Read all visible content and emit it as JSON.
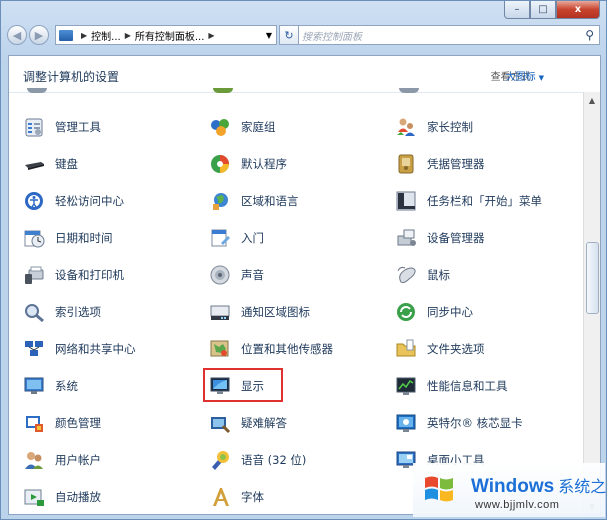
{
  "window": {
    "caption_buttons": {
      "minimize": "–",
      "maximize": "□",
      "close": "x"
    }
  },
  "nav": {
    "back_icon": "back-arrow-icon",
    "forward_icon": "forward-arrow-icon",
    "address_parts": [
      "控制...",
      "所有控制面板...",
      ""
    ],
    "refresh_icon": "refresh-icon",
    "search_placeholder": "搜索控制面板"
  },
  "header": {
    "title": "调整计算机的设置",
    "view_by_label": "查看方式:",
    "view_by_value": "大图标"
  },
  "columns": [
    {
      "items": [
        {
          "label": "管理工具",
          "icon": "admin-tools-icon"
        },
        {
          "label": "键盘",
          "icon": "keyboard-icon"
        },
        {
          "label": "轻松访问中心",
          "icon": "ease-of-access-icon"
        },
        {
          "label": "日期和时间",
          "icon": "date-time-icon"
        },
        {
          "label": "设备和打印机",
          "icon": "devices-printers-icon"
        },
        {
          "label": "索引选项",
          "icon": "indexing-options-icon"
        },
        {
          "label": "网络和共享中心",
          "icon": "network-sharing-icon"
        },
        {
          "label": "系统",
          "icon": "system-icon"
        },
        {
          "label": "颜色管理",
          "icon": "color-management-icon"
        },
        {
          "label": "用户帐户",
          "icon": "user-accounts-icon"
        },
        {
          "label": "自动播放",
          "icon": "autoplay-icon"
        }
      ]
    },
    {
      "items": [
        {
          "label": "家庭组",
          "icon": "homegroup-icon"
        },
        {
          "label": "默认程序",
          "icon": "default-programs-icon"
        },
        {
          "label": "区域和语言",
          "icon": "region-language-icon"
        },
        {
          "label": "入门",
          "icon": "getting-started-icon"
        },
        {
          "label": "声音",
          "icon": "sound-icon"
        },
        {
          "label": "通知区域图标",
          "icon": "notification-icons-icon"
        },
        {
          "label": "位置和其他传感器",
          "icon": "location-sensors-icon"
        },
        {
          "label": "显示",
          "icon": "display-icon"
        },
        {
          "label": "疑难解答",
          "icon": "troubleshooting-icon"
        },
        {
          "label": "语音 (32 位)",
          "icon": "speech-icon"
        },
        {
          "label": "字体",
          "icon": "fonts-icon"
        }
      ]
    },
    {
      "items": [
        {
          "label": "家长控制",
          "icon": "parental-controls-icon"
        },
        {
          "label": "凭据管理器",
          "icon": "credential-manager-icon"
        },
        {
          "label": "任务栏和「开始」菜单",
          "icon": "taskbar-start-menu-icon"
        },
        {
          "label": "设备管理器",
          "icon": "device-manager-icon"
        },
        {
          "label": "鼠标",
          "icon": "mouse-icon"
        },
        {
          "label": "同步中心",
          "icon": "sync-center-icon"
        },
        {
          "label": "文件夹选项",
          "icon": "folder-options-icon"
        },
        {
          "label": "性能信息和工具",
          "icon": "performance-icon"
        },
        {
          "label": "英特尔® 核芯显卡",
          "icon": "intel-graphics-icon"
        },
        {
          "label": "桌面小工具",
          "icon": "desktop-gadgets-icon"
        },
        {
          "label": "",
          "icon": ""
        }
      ]
    }
  ],
  "watermark": {
    "brand": "Windows",
    "brand_cn": "系统之家",
    "url": "www.bjjmlv.com"
  },
  "colors": {
    "accent": "#1563c0",
    "selection_border": "#e03131",
    "text": "#1e395b"
  }
}
